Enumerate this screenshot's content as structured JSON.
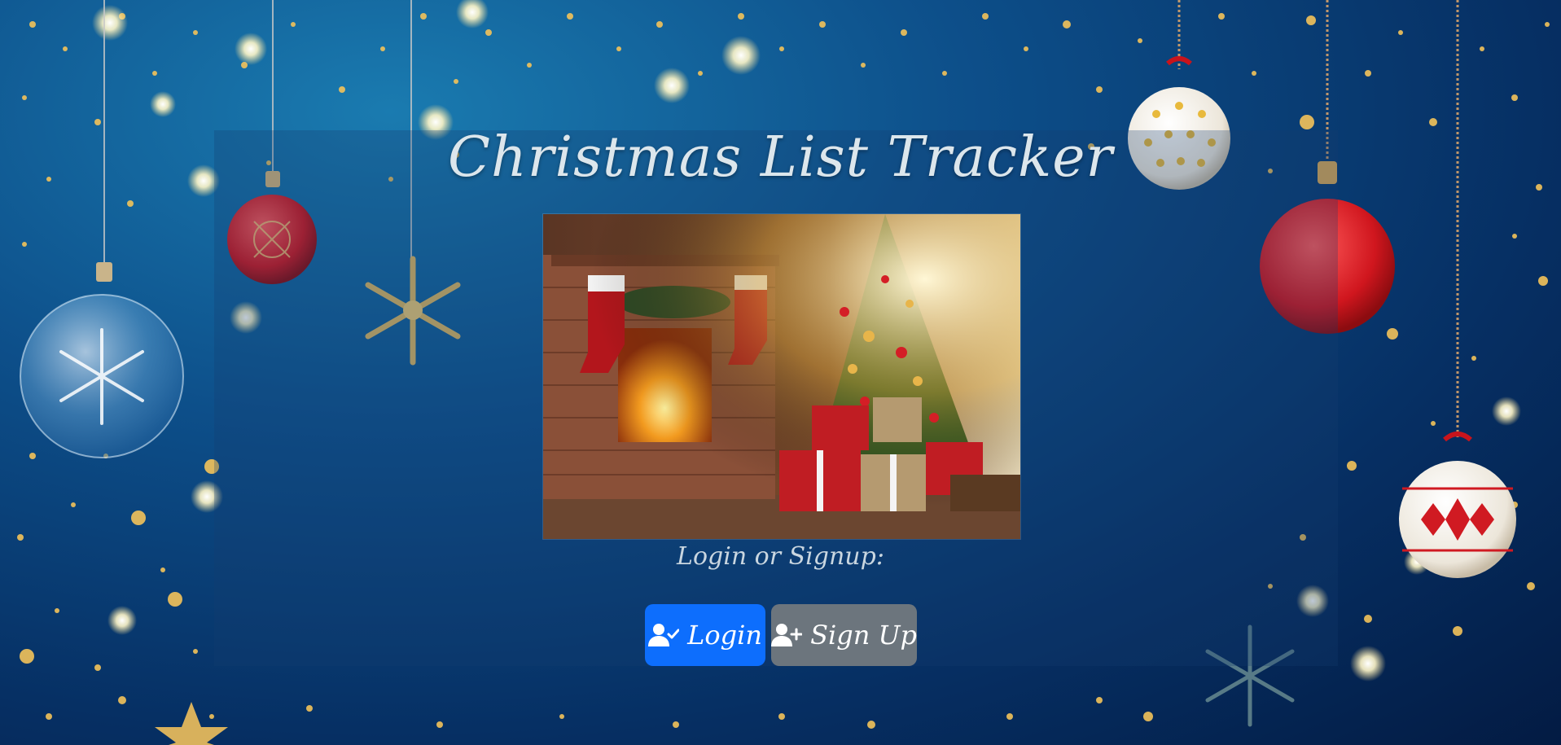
{
  "page": {
    "title": "Christmas List Tracker",
    "prompt": "Login or Signup:",
    "hero_image": "christmas-fireplace-tree-presents-photo",
    "background": "christmas-ornaments-starry-sky"
  },
  "actions": {
    "login_label": "Login",
    "login_icon": "user-check-icon",
    "signup_label": "Sign Up",
    "signup_icon": "user-plus-icon"
  },
  "colors": {
    "login_button": "#0d6efd",
    "signup_button": "#6c757d",
    "title_text": "#dce6ec",
    "background": "#0b3f79"
  }
}
